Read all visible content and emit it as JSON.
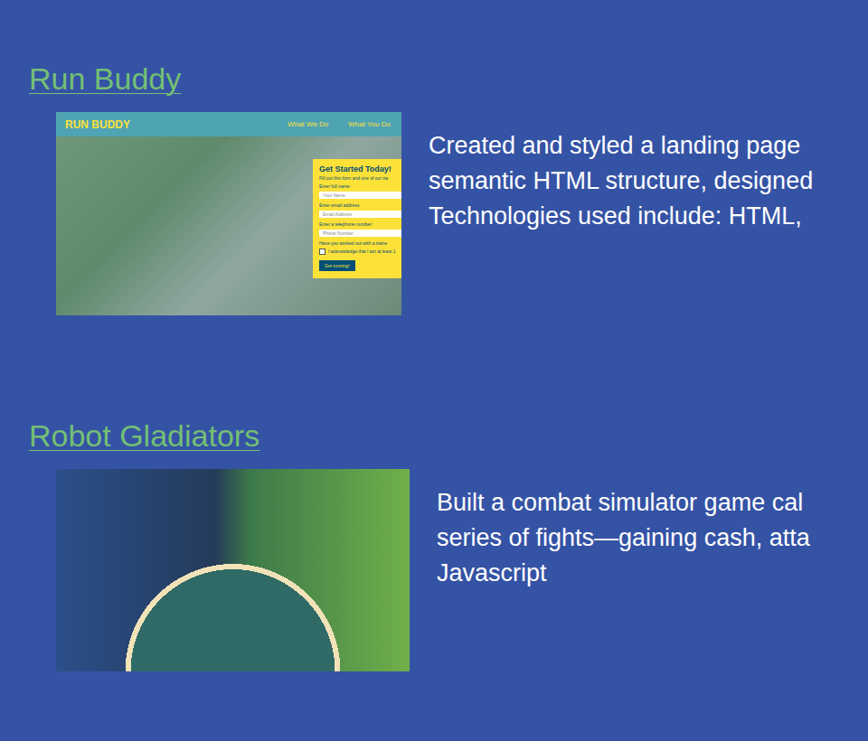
{
  "projects": [
    {
      "title": "Run Buddy",
      "kind": "site",
      "preview": {
        "brand": "RUN BUDDY",
        "nav": [
          "What We Do",
          "What You Do"
        ],
        "form": {
          "heading": "Get Started Today!",
          "intro": "Fill out this form and one of our tra",
          "fields": [
            {
              "label": "Enter full name:",
              "placeholder": "Your Name"
            },
            {
              "label": "Enter email address",
              "placeholder": "Email Address"
            },
            {
              "label": "Enter a telephone number:",
              "placeholder": "Phone Number"
            }
          ],
          "question": "Have you worked out with a traine",
          "checkbox": {
            "label": "I acknowledge that I am at least 1",
            "checked": false
          },
          "button": "Get running!"
        }
      },
      "description": [
        "Created and styled a landing page",
        "semantic HTML structure, designed",
        "Technologies used include: HTML,"
      ]
    },
    {
      "title": "Robot Gladiators",
      "kind": "artwork",
      "preview": null,
      "description": [
        "Built a combat simulator game cal",
        "series of fights—gaining cash, atta",
        "Javascript"
      ]
    }
  ]
}
